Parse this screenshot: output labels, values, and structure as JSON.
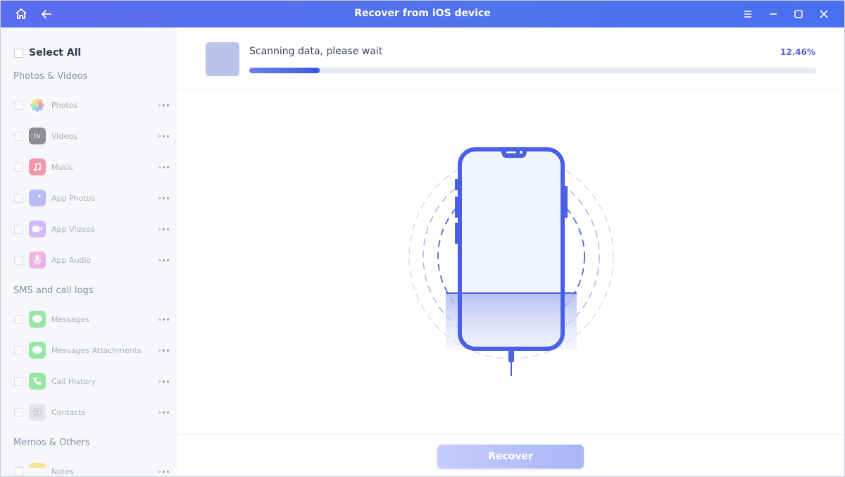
{
  "window": {
    "title": "Recover from iOS device",
    "titlebar_color": "#5a6cf0",
    "left_icons": [
      "home-icon",
      "back-arrow-icon"
    ],
    "right_icons": [
      "menu-icon",
      "minimize-icon",
      "maximize-icon",
      "close-icon"
    ]
  },
  "sidebar": {
    "select_all_label": "Select All",
    "groups": [
      {
        "label": "Photos & Videos",
        "items": [
          {
            "label": "Photos",
            "icon": "photos-icon"
          },
          {
            "label": "Videos",
            "icon": "apple-tv-icon",
            "icon_text": "tv"
          },
          {
            "label": "Music",
            "icon": "music-icon"
          },
          {
            "label": "App Photos",
            "icon": "app-photos-icon"
          },
          {
            "label": "App Videos",
            "icon": "app-videos-icon"
          },
          {
            "label": "App Audio",
            "icon": "app-audio-icon"
          }
        ]
      },
      {
        "label": "SMS and call logs",
        "items": [
          {
            "label": "Messages",
            "icon": "messages-icon"
          },
          {
            "label": "Messages Attachments",
            "icon": "messages-attachments-icon"
          },
          {
            "label": "Call History",
            "icon": "phone-icon"
          },
          {
            "label": "Contacts",
            "icon": "contacts-icon"
          }
        ]
      },
      {
        "label": "Memos & Others",
        "items": [
          {
            "label": "Notes",
            "icon": "notes-icon"
          }
        ]
      }
    ]
  },
  "main": {
    "status_text": "Scanning data, please wait",
    "progress_percent_label": "12.46%",
    "progress_fraction": 0.1246,
    "accent_color": "#4a5fe6",
    "recover_button_label": "Recover"
  }
}
